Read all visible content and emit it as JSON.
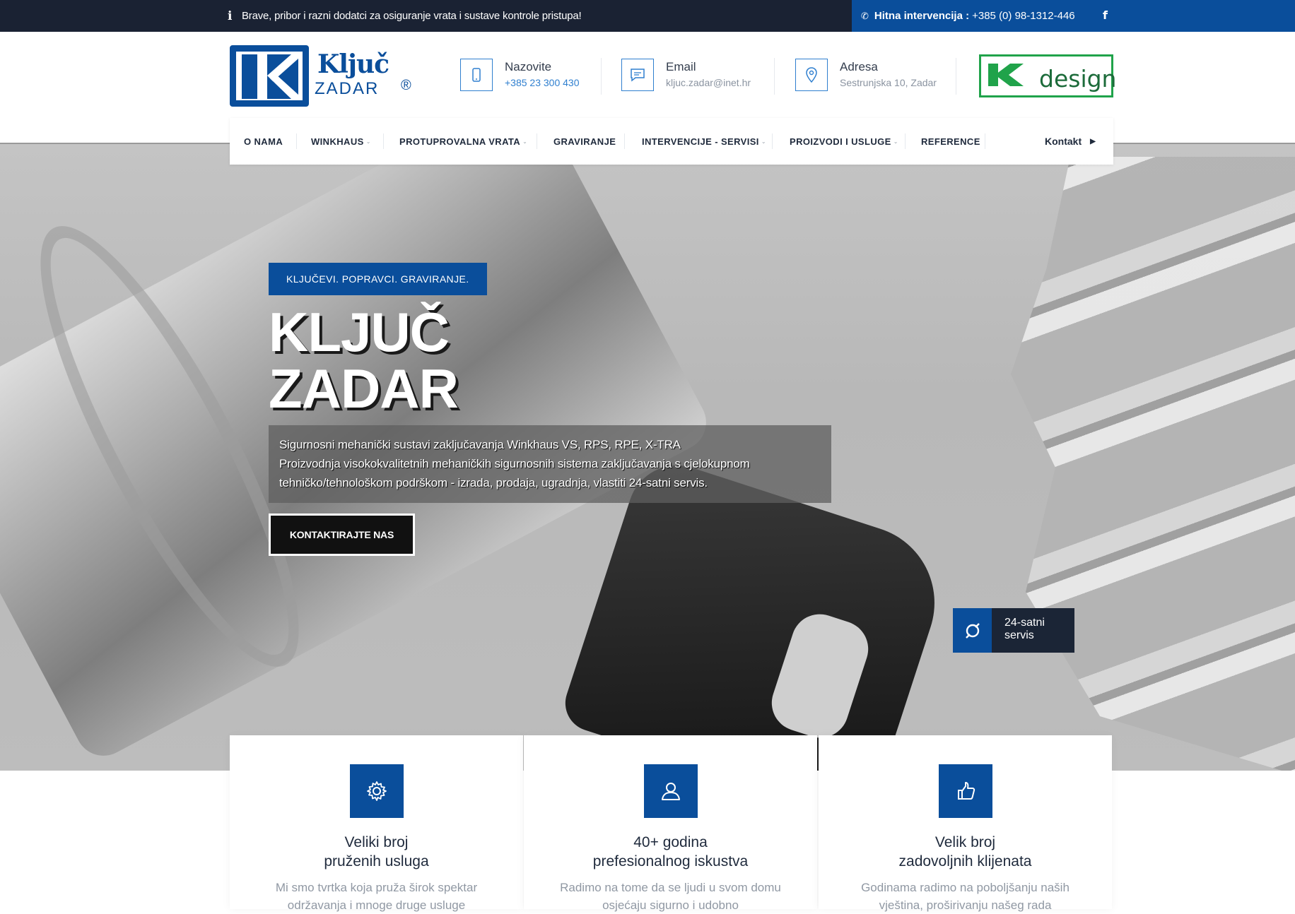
{
  "topbar": {
    "info_text": "Brave, pribor i razni dodatci za osiguranje vrata i sustave kontrole pristupa!",
    "emergency_label": "Hitna intervencija :",
    "emergency_phone": "+385 (0) 98-1312-446",
    "facebook_icon": "f"
  },
  "header": {
    "logo": {
      "main": "Ključ",
      "sub": "ZADAR",
      "reg": "®"
    },
    "contacts": [
      {
        "title": "Nazovite",
        "value": "+385 23 300 430",
        "icon": "phone-icon"
      },
      {
        "title": "Email",
        "value": "kljuc.zadar@inet.hr",
        "icon": "email-icon"
      },
      {
        "title": "Adresa",
        "value": "Sestrunjska 10, Zadar",
        "icon": "map-pin-icon"
      }
    ],
    "partner_logo": {
      "text": "design"
    }
  },
  "nav": {
    "items": [
      {
        "label": "O NAMA"
      },
      {
        "label": "WINKHAUS"
      },
      {
        "label": "PROTUPROVALNA VRATA"
      },
      {
        "label": "GRAVIRANJE"
      },
      {
        "label": "INTERVENCIJE - SERVISI"
      },
      {
        "label": "PROIZVODI I USLUGE"
      },
      {
        "label": "REFERENCE"
      }
    ],
    "contact_label": "Kontakt"
  },
  "hero": {
    "tag": "KLJUČEVI. POPRAVCI. GRAVIRANJE.",
    "title_line1": "KLJUČ",
    "title_line2": "ZADAR",
    "desc_line1": "Sigurnosni mehanički sustavi zaključavanja Winkhaus VS, RPS, RPE, X-TRA",
    "desc_line2": "Proizvodnja visokokvalitetnih mehaničkih sigurnosnih sistema zaključavanja s cjelokupnom tehničko/tehnološkom podrškom - izrada, prodaja, ugradnja, vlastiti 24-satni servis.",
    "button": "KONTAKTIRAJTE NAS",
    "badge": "24-satni servis"
  },
  "cards": [
    {
      "title_line1": "Veliki broj",
      "title_line2": "pruženih usluga",
      "text": "Mi smo tvrtka koja pruža širok spektar održavanja i mnoge druge usluge",
      "icon": "gear-icon"
    },
    {
      "title_line1": "40+ godina",
      "title_line2": "prefesionalnog iskustva",
      "text": "Radimo na tome da se ljudi u svom domu osjećaju sigurno i udobno",
      "icon": "user-icon"
    },
    {
      "title_line1": "Velik broj",
      "title_line2": "zadovoljnih klijenata",
      "text": "Godinama radimo na poboljšanju naših vještina, proširivanju našeg rada",
      "icon": "thumbs-up-icon"
    }
  ],
  "colors": {
    "brand_blue": "#0a4e9b",
    "dark": "#1a2233",
    "green": "#20a34a"
  }
}
